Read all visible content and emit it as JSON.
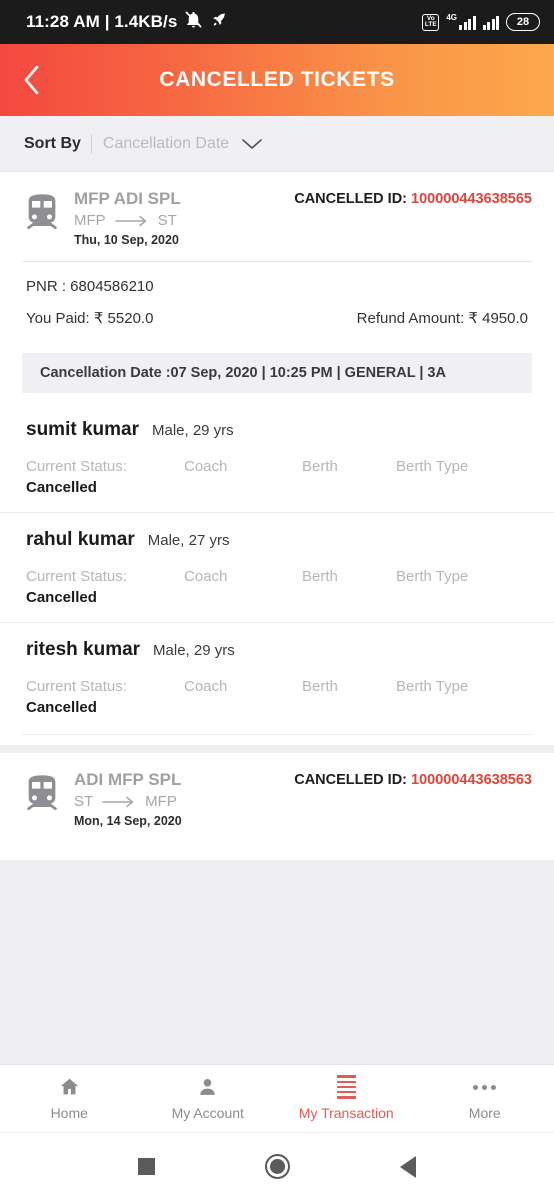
{
  "statusbar": {
    "time_text": "11:28 AM | 1.4KB/s",
    "mute_icon": "bell-muted-icon",
    "boost_icon": "rocket-icon",
    "volte_top": "Vo",
    "volte_bottom": "LTE",
    "network_type": "4G",
    "battery_level": "28"
  },
  "header": {
    "title": "CANCELLED TICKETS",
    "back_icon": "back-chevron-icon",
    "gradient_from": "#f4483f",
    "gradient_to": "#fca84c"
  },
  "sortbar": {
    "label": "Sort By",
    "value": "Cancellation Date",
    "caret_icon": "chevron-down-icon"
  },
  "colors": {
    "accent_red": "#e1443a",
    "nav_active": "#e05c56",
    "page_bg": "#eeeef2"
  },
  "tickets": [
    {
      "train_name": "MFP ADI SPL",
      "from": "MFP",
      "to": "ST",
      "travel_date": "Thu, 10 Sep, 2020",
      "cancelled_id_label": "CANCELLED ID:",
      "cancelled_id": "100000443638565",
      "pnr": "PNR : 6804586210",
      "paid_label": "You Paid: ₹ 5520.0",
      "refund_label": "Refund Amount: ₹ 4950.0",
      "cancellation_banner": "Cancellation Date :07 Sep, 2020 | 10:25 PM | GENERAL  | 3A",
      "columns": [
        "Current Status:",
        "Coach",
        "Berth",
        "Berth Type"
      ],
      "passengers": [
        {
          "name": "sumit kumar",
          "detail": "Male, 29 yrs",
          "status": "Cancelled",
          "coach": "",
          "berth": "",
          "berth_type": ""
        },
        {
          "name": "rahul kumar",
          "detail": "Male, 27 yrs",
          "status": "Cancelled",
          "coach": "",
          "berth": "",
          "berth_type": ""
        },
        {
          "name": "ritesh kumar",
          "detail": "Male, 29 yrs",
          "status": "Cancelled",
          "coach": "",
          "berth": "",
          "berth_type": ""
        }
      ]
    },
    {
      "train_name": "ADI MFP SPL",
      "from": "ST",
      "to": "MFP",
      "travel_date": "Mon, 14 Sep, 2020",
      "cancelled_id_label": "CANCELLED ID:",
      "cancelled_id": "100000443638563"
    }
  ],
  "bottomnav": {
    "items": [
      {
        "label": "Home",
        "icon": "home-icon",
        "active": false
      },
      {
        "label": "My Account",
        "icon": "person-icon",
        "active": false
      },
      {
        "label": "My Transaction",
        "icon": "list-icon",
        "active": true
      },
      {
        "label": "More",
        "icon": "more-dots-icon",
        "active": false
      }
    ]
  },
  "androidnav": {
    "recent_icon": "square-recents-icon",
    "home_icon": "circle-home-icon",
    "back_icon": "triangle-back-icon"
  }
}
